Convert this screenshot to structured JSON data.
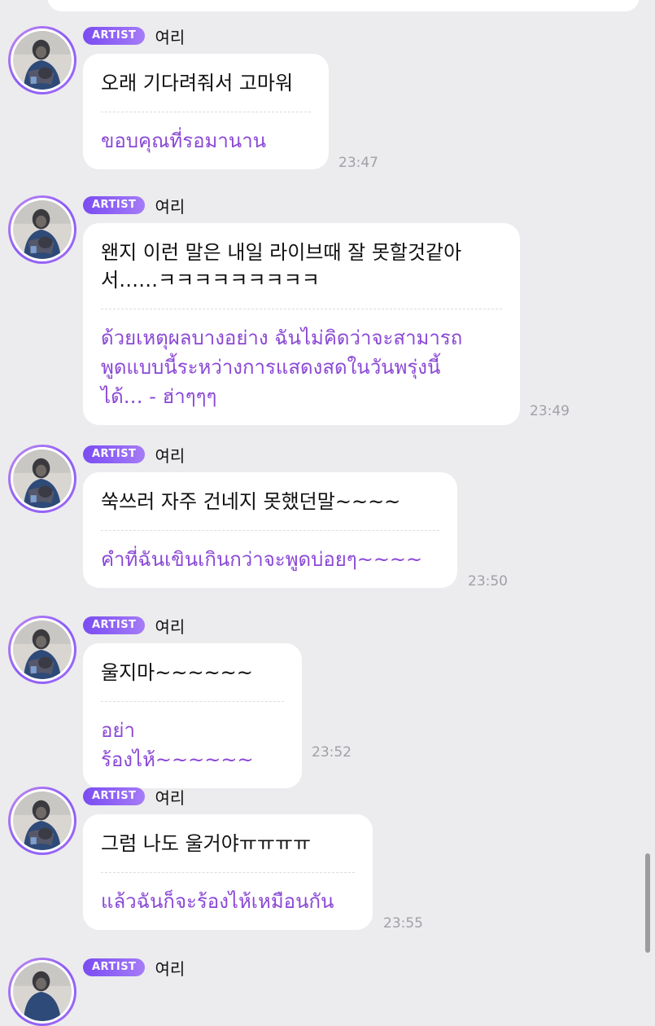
{
  "colors": {
    "background": "#ececee",
    "bubble": "#ffffff",
    "badge_gradient_start": "#7a4cf2",
    "badge_gradient_end": "#a57cf7",
    "translation_text": "#8a48d6",
    "timestamp": "#a0a0a8"
  },
  "avatar_icon": "artist-profile-photo",
  "messages": [
    {
      "badge": "ARTIST",
      "name": "여리",
      "korean": "오래 기다려줘서 고마워",
      "thai": "ขอบคุณที่รอมานาน",
      "time": "23:47"
    },
    {
      "badge": "ARTIST",
      "name": "여리",
      "korean": "왠지 이런 말은 내일 라이브때 잘 못할것같아\n서……ㅋㅋㅋㅋㅋㅋㅋㅋㅋ",
      "thai": "ด้วยเหตุผลบางอย่าง ฉันไม่คิดว่าจะสามารถ\nพูดแบบนี้ระหว่างการแสดงสดในวันพรุ่งนี้\nได้… - ฮ่าๆๆๆ",
      "time": "23:49"
    },
    {
      "badge": "ARTIST",
      "name": "여리",
      "korean": "쑥쓰러 자주 건네지 못했던말~~~~",
      "thai": "คำที่ฉันเขินเกินกว่าจะพูดบ่อยๆ~~~~",
      "time": "23:50"
    },
    {
      "badge": "ARTIST",
      "name": "여리",
      "korean": "울지마~~~~~~",
      "thai": "อย่าร้องไห้~~~~~~",
      "time": "23:52"
    },
    {
      "badge": "ARTIST",
      "name": "여리",
      "korean": "그럼 나도 울거야ㅠㅠㅠㅠ",
      "thai": "แล้วฉันก็จะร้องไห้เหมือนกัน",
      "time": "23:55"
    },
    {
      "badge": "ARTIST",
      "name": "여리"
    }
  ]
}
